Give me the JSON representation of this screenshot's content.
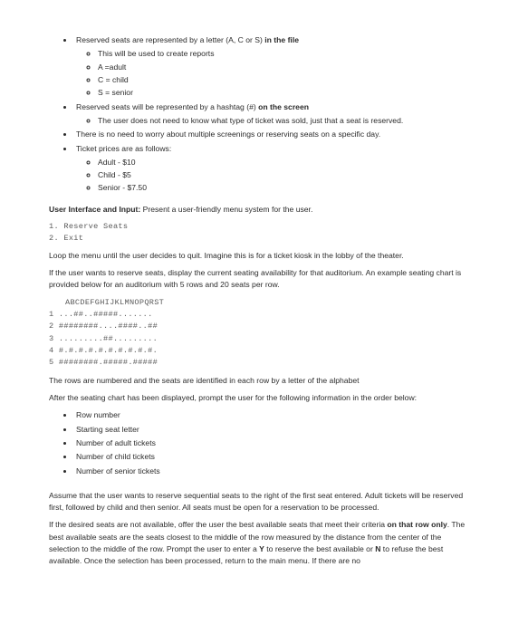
{
  "list1": {
    "i0": {
      "prefix": "Reserved seats are represented by a letter (A, C or S) ",
      "bold": "in the file",
      "sub": {
        "s0": "This will be used to create reports",
        "s1": "A =adult",
        "s2": "C = child",
        "s3": "S = senior"
      }
    },
    "i1": {
      "prefix": "Reserved seats will be represented by a hashtag (#) ",
      "bold": "on the screen",
      "sub": {
        "s0": "The user does not need to know what type of ticket was sold, just that a seat is reserved."
      }
    },
    "i2": {
      "text": "There is no need to worry about multiple screenings or reserving seats on a specific day."
    },
    "i3": {
      "text": "Ticket prices are as follows:",
      "sub": {
        "s0": "Adult - $10",
        "s1": "Child - $5",
        "s2": "Senior - $7.50"
      }
    }
  },
  "ui_label_bold": "User Interface and Input:",
  "ui_label_rest": " Present a user-friendly menu system for the user.",
  "menu": "1. Reserve Seats\n2. Exit",
  "loop_para": "Loop the menu until the user decides to quit.  Imagine this is for a ticket kiosk in the lobby of the theater.",
  "avail_para": "If the user wants to reserve seats, display the current seating availability for that auditorium.  An example seating chart is provided below for an auditorium with 5 rows and 20 seats per row.",
  "chart": {
    "header": "ABCDEFGHIJKLMNOPQRST",
    "rows": {
      "r0": "1 ...##..#####.......",
      "r1": "2 ########....####..##",
      "r2": "3 .........##.........",
      "r3": "4 #.#.#.#.#.#.#.#.#.#.",
      "r4": "5 ########.#####.#####"
    }
  },
  "rows_para": "The rows are numbered and the seats are identified in each row by a letter of the alphabet",
  "prompt_para": "After the seating chart has been displayed, prompt the user for the following information in the order below:",
  "list2": {
    "b0": "Row number",
    "b1": "Starting seat letter",
    "b2": "Number of adult tickets",
    "b3": "Number of child tickets",
    "b4": "Number of senior tickets"
  },
  "assume_para": "Assume that the user wants to reserve sequential seats to the right of the first seat entered.  Adult tickets will be reserved first, followed by child and then senior.  All seats must be open for a reservation to be processed.",
  "best": {
    "p1": "If the desired seats are not available, offer the user the best available seats that meet their criteria ",
    "b1": "on that row only",
    "p2": ".  The best available seats are the seats closest to the middle of the row measured by the distance from the center of the selection to the middle of the row.  Prompt the user to enter a ",
    "b2": "Y",
    "p3": " to reserve the best available or ",
    "b3": "N",
    "p4": " to refuse the best available.  Once the selection has been processed, return to the main menu.  If there are no"
  }
}
